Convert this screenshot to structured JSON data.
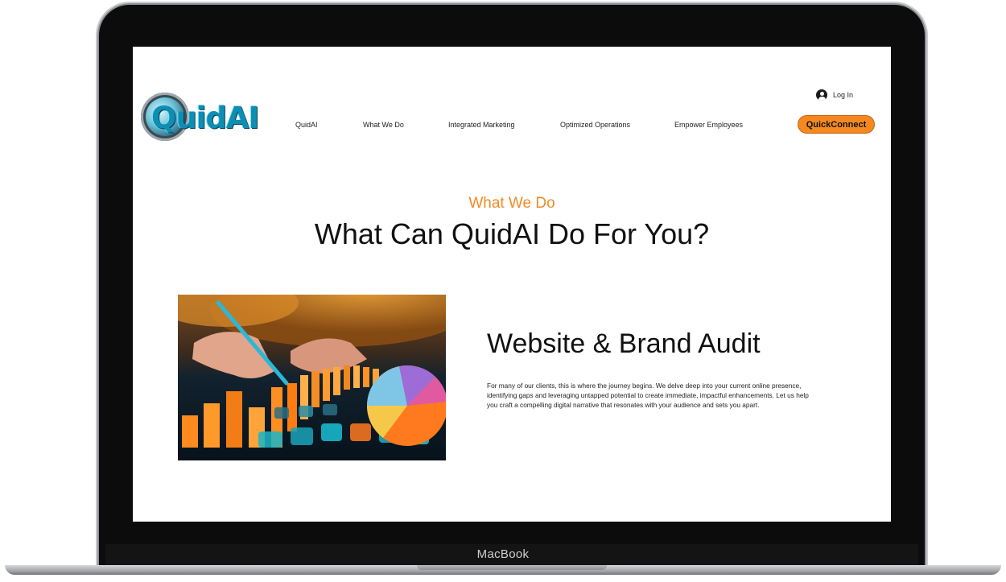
{
  "device": {
    "brand_label": "MacBook"
  },
  "site": {
    "logo_text": "QuidAI",
    "nav": [
      {
        "label": "QuidAI"
      },
      {
        "label": "What We Do"
      },
      {
        "label": "Integrated Marketing"
      },
      {
        "label": "Optimized Operations"
      },
      {
        "label": "Empower Employees"
      }
    ],
    "login_label": "Log In",
    "cta_label": "QuickConnect",
    "colors": {
      "accent": "#f5891f",
      "eyebrow": "#f28a25",
      "text": "#111111",
      "logo": "#0e8eb3"
    }
  },
  "hero": {
    "eyebrow": "What We Do",
    "headline": "What Can QuidAI Do For You?"
  },
  "feature": {
    "image_icon": "analytics-photo",
    "title": "Website & Brand Audit",
    "body": "For many of our clients, this is where the journey begins. We delve deep into your current online presence, identifying gaps and leveraging untapped potential to create immediate, impactful enhancements. Let us help you craft a compelling digital narrative that resonates with your audience and sets you apart."
  }
}
